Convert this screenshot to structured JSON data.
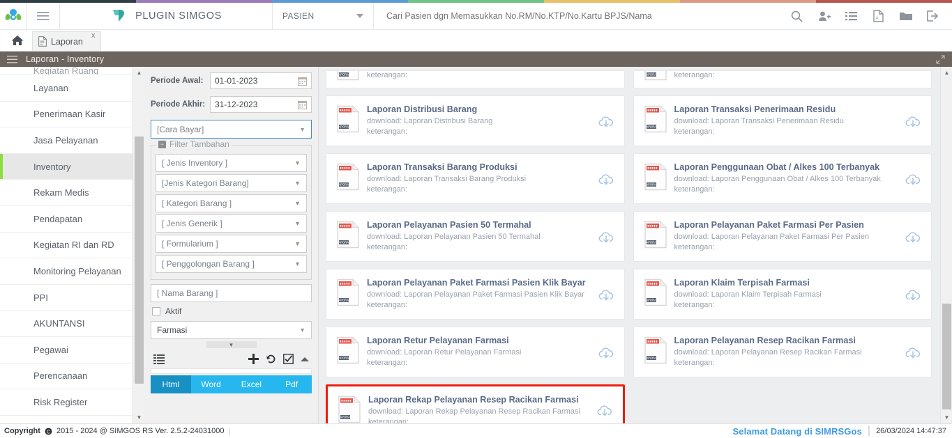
{
  "colors": {
    "strip": [
      "#2f3d44",
      "#9b7cb8",
      "#5b9bd5",
      "#71c286",
      "#e8c06a",
      "#dc9b85",
      "#b5574e"
    ],
    "accent_green": "#8ade3e",
    "accent_blue": "#27b7ef",
    "highlight_red": "#ef1b0f",
    "welcome_blue": "#3f9ae0"
  },
  "topbar": {
    "logo_icon": "simgos-logo-icon",
    "hamburger_icon": "hamburger-icon",
    "plugin_icon": "plugin-leaf-icon",
    "plugin_title": "PLUGIN SIMGOS",
    "pasien_select": "PASIEN",
    "pasien_caret_icon": "chevron-down-icon",
    "search_placeholder": "Cari Pasien dgn Memasukkan No.RM/No.KTP/No.Kartu BPJS/Nama",
    "search_value": "",
    "icons": [
      {
        "name": "search-icon",
        "glyph": "search"
      },
      {
        "name": "add-user-icon",
        "glyph": "user-plus"
      },
      {
        "name": "list-icon",
        "glyph": "list"
      },
      {
        "name": "pdf-icon",
        "glyph": "pdf"
      },
      {
        "name": "folder-icon",
        "glyph": "folder"
      },
      {
        "name": "logout-icon",
        "glyph": "logout"
      }
    ]
  },
  "tabbar": {
    "home_icon": "home-icon",
    "tabs": [
      {
        "label": "Laporan",
        "icon": "document-icon",
        "close": "x",
        "active": true
      }
    ]
  },
  "pagebar": {
    "menu_icon": "hamburger-icon",
    "title": "Laporan - Inventory",
    "expand_icon": "expand-arrows-icon"
  },
  "sidebar": {
    "partial_top_label": "Kegiatan Ruang",
    "items": [
      {
        "label": "Layanan",
        "active": false
      },
      {
        "label": "Penerimaan Kasir",
        "active": false
      },
      {
        "label": "Jasa Pelayanan",
        "active": false
      },
      {
        "label": "Inventory",
        "active": true
      },
      {
        "label": "Rekam Medis",
        "active": false
      },
      {
        "label": "Pendapatan",
        "active": false
      },
      {
        "label": "Kegiatan RI dan RD",
        "active": false
      },
      {
        "label": "Monitoring Pelayanan",
        "active": false
      },
      {
        "label": "PPI",
        "active": false
      },
      {
        "label": "AKUNTANSI",
        "active": false
      },
      {
        "label": "Pegawai",
        "active": false
      },
      {
        "label": "Perencanaan",
        "active": false
      },
      {
        "label": "Risk Register",
        "active": false
      }
    ]
  },
  "filter": {
    "periode_awal_label": "Periode Awal:",
    "periode_awal_value": "01-01-2023",
    "periode_akhir_label": "Periode Akhir:",
    "periode_akhir_value": "31-12-2023",
    "calendar_icon": "calendar-icon",
    "cara_bayar": "[Cara Bayar]",
    "fieldset_legend": "Filter Tambahan",
    "collapse_glyph": "−",
    "selects": [
      "[ Jenis Inventory ]",
      "[Jenis Kategori Barang]",
      "[ Kategori Barang ]",
      "[ Jenis Generik ]",
      "[ Formularium ]",
      "[ Penggolongan Barang ]"
    ],
    "nama_barang": "[ Nama Barang ]",
    "aktif_label": "Aktif",
    "aktif_checked": false,
    "unit_value": "Farmasi",
    "toolbar": {
      "list_icon": "list-lines-icon",
      "add_icon": "plus-icon",
      "reset_icon": "history-reset-icon",
      "check_icon": "checkbox-checked-icon",
      "collapse_icon": "chevron-up-icon"
    },
    "export_tabs": [
      {
        "label": "Html",
        "active": true
      },
      {
        "label": "Word",
        "active": false
      },
      {
        "label": "Excel",
        "active": false
      },
      {
        "label": "Pdf",
        "active": false
      }
    ]
  },
  "main": {
    "download_prefix": "download: ",
    "note_label": "keterangan:",
    "report_icon": "report-file-icon",
    "download_icon": "cloud-download-icon",
    "cards": [
      {
        "title": "",
        "download": "",
        "note": "keterangan:",
        "clipped": true,
        "highlighted": false
      },
      {
        "title": "",
        "download": "",
        "note": "keterangan:",
        "clipped": true,
        "highlighted": false
      },
      {
        "title": "Laporan Distribusi Barang",
        "download": "download: Laporan Distribusi Barang",
        "note": "keterangan:",
        "clipped": false,
        "highlighted": false
      },
      {
        "title": "Laporan Transaksi Penerimaan Residu",
        "download": "download: Laporan Transaksi Penerimaan Residu",
        "note": "keterangan:",
        "clipped": false,
        "highlighted": false
      },
      {
        "title": "Laporan Transaksi Barang Produksi",
        "download": "download: Laporan Transaksi Barang Produksi",
        "note": "keterangan:",
        "clipped": false,
        "highlighted": false
      },
      {
        "title": "Laporan Penggunaan Obat / Alkes 100 Terbanyak",
        "download": "download: Laporan Penggunaan Obat / Alkes 100 Terbanyak",
        "note": "keterangan:",
        "clipped": false,
        "highlighted": false
      },
      {
        "title": "Laporan Pelayanan Pasien 50 Termahal",
        "download": "download: Laporan Pelayanan Pasien 50 Termahal",
        "note": "keterangan:",
        "clipped": false,
        "highlighted": false
      },
      {
        "title": "Laporan Pelayanan Paket Farmasi Per Pasien",
        "download": "download: Laporan Pelayanan Paket Farmasi Per Pasien",
        "note": "keterangan:",
        "clipped": false,
        "highlighted": false
      },
      {
        "title": "Laporan Pelayanan Paket Farmasi Pasien Klik Bayar",
        "download": "download: Laporan Pelayanan Paket Farmasi Pasien Klik Bayar",
        "note": "keterangan:",
        "clipped": false,
        "highlighted": false
      },
      {
        "title": "Laporan Klaim Terpisah Farmasi",
        "download": "download: Laporan Klaim Terpisah Farmasi",
        "note": "keterangan:",
        "clipped": false,
        "highlighted": false
      },
      {
        "title": "Laporan Retur Pelayanan Farmasi",
        "download": "download: Laporan Retur Pelayanan Farmasi",
        "note": "keterangan:",
        "clipped": false,
        "highlighted": false
      },
      {
        "title": "Laporan Pelayanan Resep Racikan Farmasi",
        "download": "download: Laporan Pelayanan Resep Racikan Farmasi",
        "note": "keterangan:",
        "clipped": false,
        "highlighted": false
      },
      {
        "title": "Laporan Rekap Pelayanan Resep Racikan Farmasi",
        "download": "download: Laporan Rekap Pelayanan Resep Racikan Farmasi",
        "note": "keterangan:",
        "clipped": false,
        "highlighted": true
      }
    ]
  },
  "footer": {
    "copyright_label": "Copyright",
    "copyright_icon": "copyright-icon",
    "copyright_text": "2015 - 2024 @ SIMGOS RS Ver. 2.5.2-24031000",
    "welcome": "Selamat Datang di SIMRSGos",
    "timestamp": "26/03/2024 14:47:37"
  }
}
